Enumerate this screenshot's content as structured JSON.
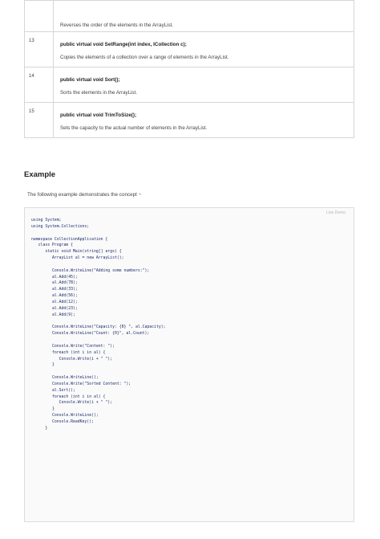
{
  "methods": [
    {
      "num": "",
      "signature": "",
      "description": "Reverses the order of the elements in the ArrayList."
    },
    {
      "num": "13",
      "signature": "public virtual void SetRange(int index, ICollection c);",
      "description": "Copies the elements of a collection over a range of elements in the ArrayList."
    },
    {
      "num": "14",
      "signature": "public virtual void Sort();",
      "description": "Sorts the elements in the ArrayList."
    },
    {
      "num": "15",
      "signature": "public virtual void TrimToSize();",
      "description": "Sets the capacity to the actual number of elements in the ArrayList."
    }
  ],
  "example": {
    "heading": "Example",
    "intro": "The following example demonstrates the concept −",
    "live_demo_label": "Live Demo",
    "code_lines": [
      "using System;",
      "using System.Collections;",
      "",
      "namespace CollectionApplication {",
      "   class Program {",
      "      static void Main(string[] args) {",
      "         ArrayList al = new ArrayList();",
      "",
      "         Console.WriteLine(\"Adding some numbers:\");",
      "         al.Add(45);",
      "         al.Add(78);",
      "         al.Add(33);",
      "         al.Add(56);",
      "         al.Add(12);",
      "         al.Add(23);",
      "         al.Add(9);",
      "",
      "         Console.WriteLine(\"Capacity: {0} \", al.Capacity);",
      "         Console.WriteLine(\"Count: {0}\", al.Count);",
      "",
      "         Console.Write(\"Content: \");",
      "         foreach (int i in al) {",
      "            Console.Write(i + \" \");",
      "         }",
      "",
      "         Console.WriteLine();",
      "         Console.Write(\"Sorted Content: \");",
      "         al.Sort();",
      "         foreach (int i in al) {",
      "            Console.Write(i + \" \");",
      "         }",
      "         Console.WriteLine();",
      "         Console.ReadKey();",
      "      }"
    ]
  }
}
